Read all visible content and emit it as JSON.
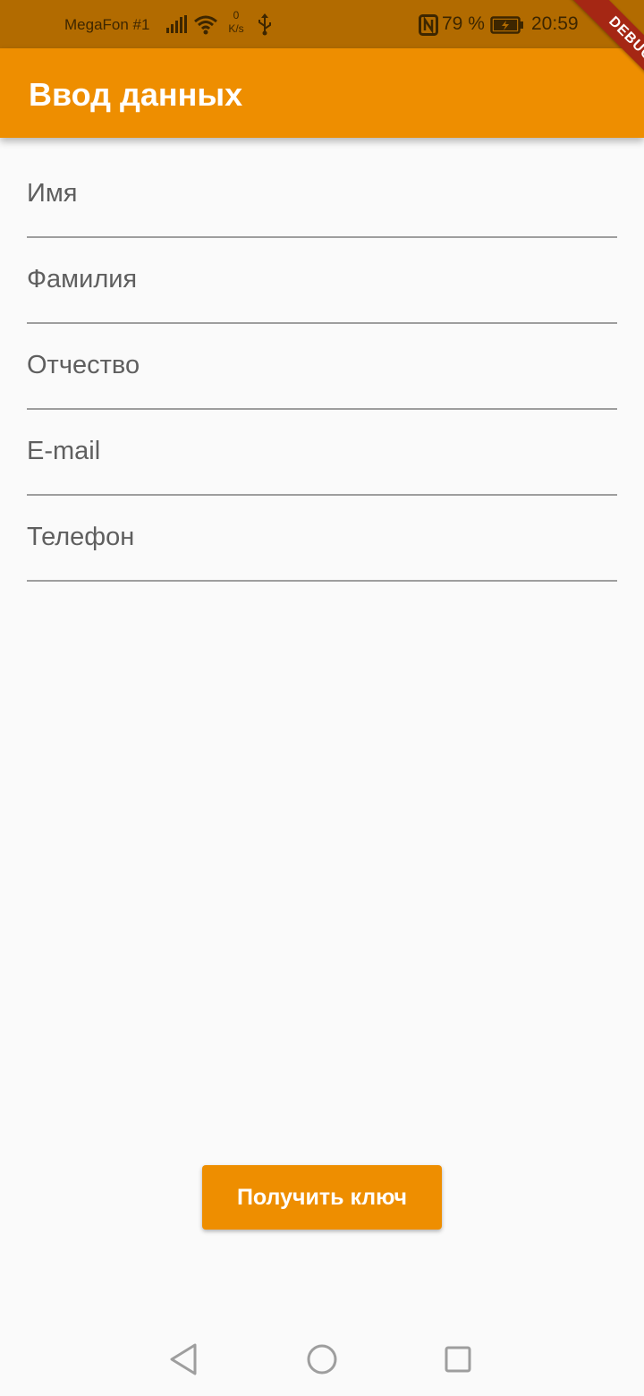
{
  "status_bar": {
    "carrier": "MegaFon #1",
    "speed_value": "0",
    "speed_unit": "K/s",
    "battery": "79 %",
    "time": "20:59",
    "icons": [
      "signal-icon",
      "wifi-icon",
      "usb-icon",
      "nfc-icon",
      "battery-charging-icon"
    ]
  },
  "debug_banner": "DEBUG",
  "app_bar": {
    "title": "Ввод данных"
  },
  "form": {
    "fields": [
      {
        "label": "Имя",
        "value": ""
      },
      {
        "label": "Фамилия",
        "value": ""
      },
      {
        "label": "Отчество",
        "value": ""
      },
      {
        "label": "E-mail",
        "value": ""
      },
      {
        "label": "Телефон",
        "value": ""
      }
    ],
    "submit_label": "Получить ключ"
  },
  "nav_bar": {
    "icons": [
      "back-triangle-icon",
      "home-circle-icon",
      "recents-square-icon"
    ]
  },
  "colors": {
    "primary": "#ee8e00",
    "status_bar": "#b26b00",
    "debug_ribbon": "#a52714",
    "background": "#fafafa"
  }
}
